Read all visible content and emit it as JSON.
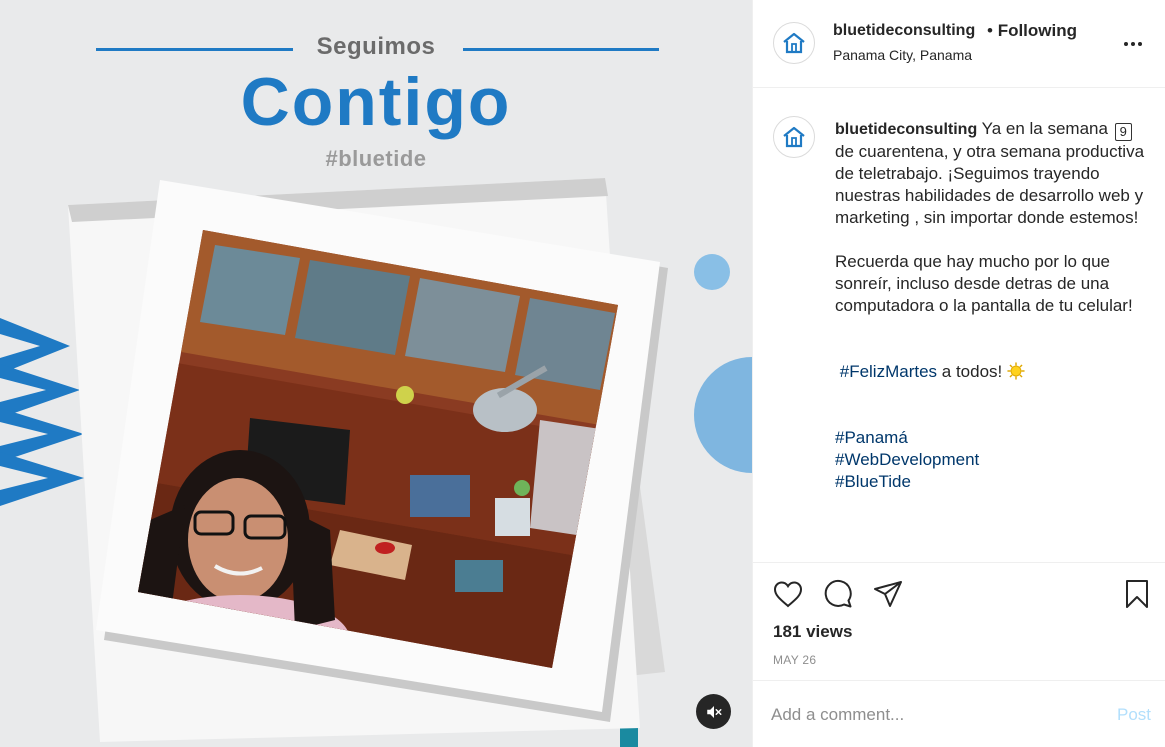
{
  "media": {
    "title_small": "Seguimos",
    "title_big": "Contigo",
    "brand_hashtag": "#bluetide",
    "mute_icon": "speaker-muted-icon"
  },
  "post": {
    "username": "bluetideconsulting",
    "follow_separator": "•",
    "follow_status": "Following",
    "location": "Panama City, Panama",
    "more_icon": "more-options-icon"
  },
  "caption": {
    "username": "bluetideconsulting",
    "p1_pre": "Ya en la semana",
    "p1_num": "9",
    "p1_post": "de cuarentena, y otra semana productiva de teletrabajo. ¡Seguimos trayendo nuestras habilidades de desarrollo web y marketing , sin importar donde estemos!",
    "p2": "Recuerda que hay mucho por lo que sonreír, incluso desde detras de una computadora o la pantalla de tu celular!",
    "p3_tag": "#FelizMartes",
    "p3_text": "a todos!",
    "tags": [
      "#Panamá",
      "#WebDevelopment",
      "#BlueTide"
    ]
  },
  "actions": {
    "like_icon": "heart-icon",
    "comment_icon": "comment-icon",
    "share_icon": "share-icon",
    "save_icon": "bookmark-icon",
    "views": "181 views",
    "date": "MAY 26"
  },
  "comment": {
    "placeholder": "Add a comment...",
    "post_label": "Post"
  },
  "colors": {
    "brand_blue": "#1f7ac4",
    "link": "#00376b",
    "post_disabled": "#b2dffc"
  }
}
